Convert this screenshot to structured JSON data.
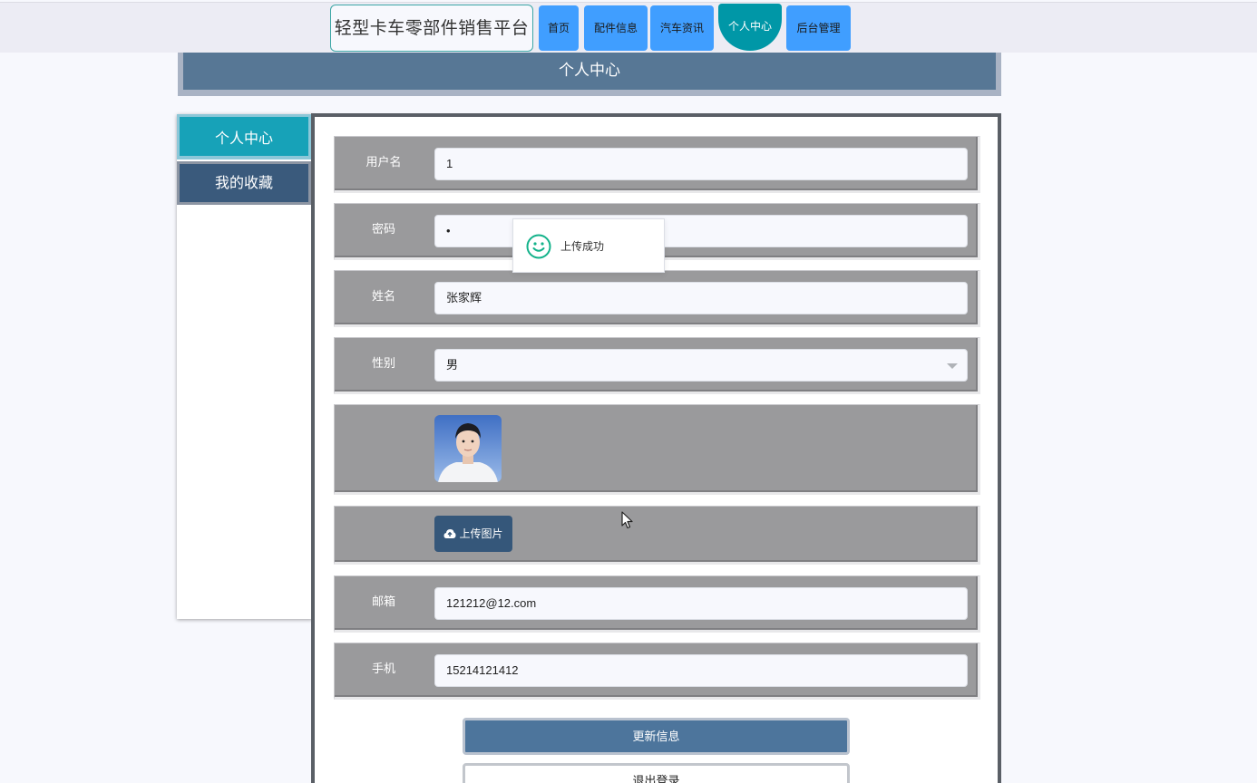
{
  "header": {
    "brand": "轻型卡车零部件销售平台",
    "nav": [
      {
        "label": "首页"
      },
      {
        "label": "配件信息"
      },
      {
        "label": "汽车资讯"
      },
      {
        "label": "个人中心",
        "active": true
      },
      {
        "label": "后台管理"
      }
    ]
  },
  "banner": {
    "title": "个人中心"
  },
  "sidebar": {
    "items": [
      {
        "label": "个人中心",
        "active": true
      },
      {
        "label": "我的收藏"
      }
    ]
  },
  "form": {
    "username": {
      "label": "用户名",
      "value": "1"
    },
    "password": {
      "label": "密码",
      "value": "•"
    },
    "name": {
      "label": "姓名",
      "value": "张家辉"
    },
    "gender": {
      "label": "性别",
      "value": "男"
    },
    "upload_label": "上传图片",
    "email": {
      "label": "邮箱",
      "value": "121212@12.com"
    },
    "phone": {
      "label": "手机",
      "value": "15214121412"
    }
  },
  "buttons": {
    "update": "更新信息",
    "logout": "退出登录"
  },
  "toast": {
    "message": "上传成功",
    "icon": "smile-icon"
  },
  "colors": {
    "nav_button": "#409eff",
    "nav_active": "#0097a7",
    "banner": "#577795",
    "row_bg": "#9a9a9c",
    "update_button": "#4d759c",
    "upload_button": "#35577a"
  }
}
